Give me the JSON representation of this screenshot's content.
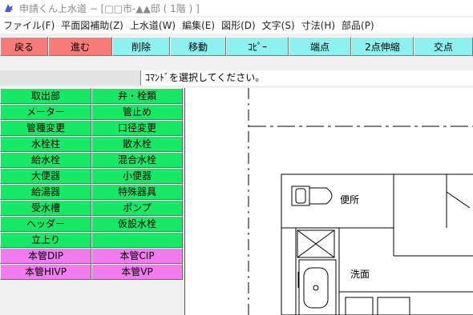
{
  "window": {
    "title": "申請くん上水道 − [□□市-▲▲邸 ( 1階 ) ]"
  },
  "menu": [
    "ファイル(F)",
    "平面図補助(Z)",
    "上水道(W)",
    "編集(E)",
    "図形(D)",
    "文字(S)",
    "寸法(H)",
    "部品(P)"
  ],
  "toolbar": [
    {
      "label": "戻る",
      "color": "#f77b7b",
      "w": 60
    },
    {
      "label": "進む",
      "color": "#f77b7b",
      "w": 80
    },
    {
      "label": "削除",
      "color": "#8ff0f0",
      "w": 72
    },
    {
      "label": "移動",
      "color": "#8ff0f0",
      "w": 70
    },
    {
      "label": "ｺﾋﾟｰ",
      "color": "#8ff0f0",
      "w": 78
    },
    {
      "label": "端点",
      "color": "#8ff0f0",
      "w": 78
    },
    {
      "label": "2点伸縮",
      "color": "#8ff0f0",
      "w": 78
    },
    {
      "label": "交点",
      "color": "#8ff0f0",
      "w": 74
    }
  ],
  "command_prompt": "ｺﾏﾝﾄﾞを選択してください。",
  "palette": [
    [
      "取出部",
      "弁・栓類"
    ],
    [
      "メーター",
      "管止め"
    ],
    [
      "管種変更",
      "口径変更"
    ],
    [
      "水栓柱",
      "散水栓"
    ],
    [
      "給水栓",
      "混合水栓"
    ],
    [
      "大便器",
      "小便器"
    ],
    [
      "給湯器",
      "特殊器具"
    ],
    [
      "受水槽",
      "ポンプ"
    ],
    [
      "ヘッダー",
      "仮設水栓"
    ],
    [
      "立上り",
      ""
    ],
    [
      "本管DIP",
      "本管CIP"
    ],
    [
      "本管HIVP",
      "本管VP"
    ]
  ],
  "palette_pink_rows": [
    10,
    11
  ],
  "drawing": {
    "toilet_label": "便所",
    "washroom_label": "洗面"
  }
}
